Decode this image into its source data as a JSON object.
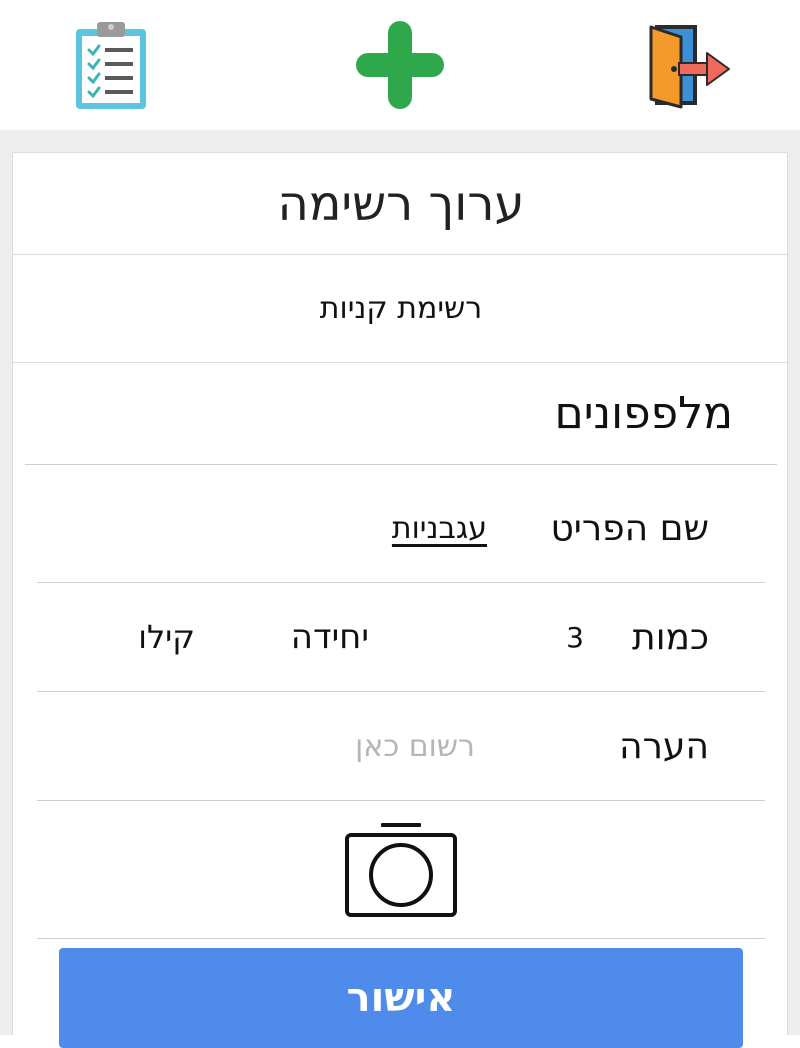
{
  "toolbar": {
    "list_icon": "clipboard-checklist-icon",
    "add_icon": "plus-icon",
    "exit_icon": "exit-door-icon",
    "add_color": "#2ea84a"
  },
  "card": {
    "title": "ערוך רשימה",
    "list_name": "רשימת קניות",
    "item_heading": "מלפפונים"
  },
  "form": {
    "item_name_label": "שם הפריט",
    "item_name_value": "עגבניות",
    "quantity_label": "כמות",
    "quantity_value": "3",
    "unit_label": "יחידה",
    "unit_value": "קילו",
    "note_label": "הערה",
    "note_placeholder": "רשום כאן",
    "camera_icon": "camera-icon"
  },
  "actions": {
    "confirm_label": "אישור",
    "confirm_color": "#4f8bea"
  }
}
